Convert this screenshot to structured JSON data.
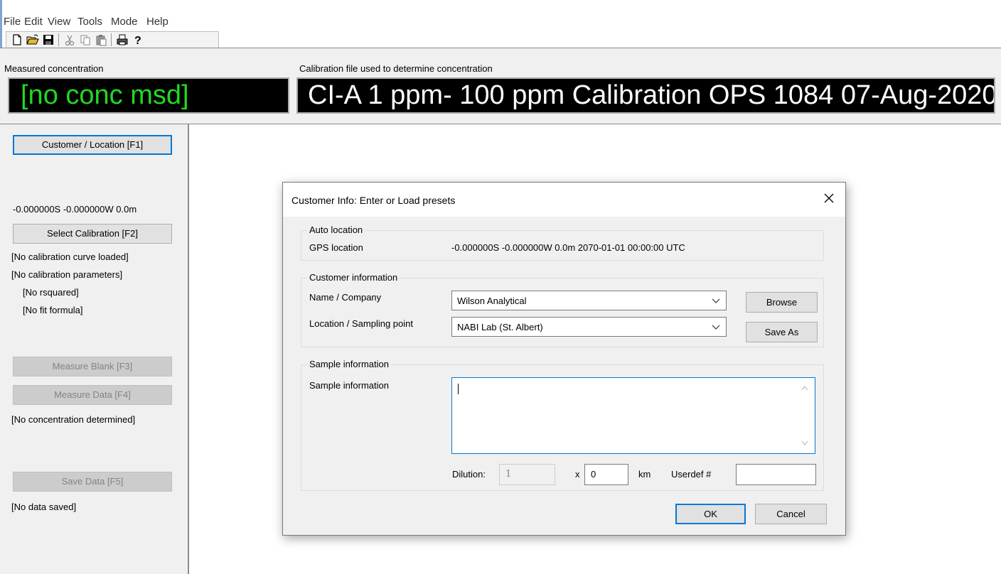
{
  "menu": [
    "File",
    "Edit",
    "View",
    "Tools",
    "Mode",
    "Help"
  ],
  "toolbar_icons": [
    "new-file-icon",
    "open-folder-icon",
    "save-disk-icon",
    "cut-icon",
    "copy-icon",
    "paste-icon",
    "print-icon",
    "help-icon"
  ],
  "header": {
    "conc_label": "Measured concentration",
    "conc_value": "[no conc msd]",
    "calib_label": "Calibration file used to determine concentration",
    "calib_value": "CI-A 1 ppm- 100 ppm Calibration OPS 1084 07-Aug-2020",
    "conc_color": "#21d921"
  },
  "left": {
    "customer_button": "Customer / Location [F1]",
    "gps": "-0.000000S -0.000000W 0.0m",
    "select_calibration": "Select Calibration [F2]",
    "no_curve": "[No calibration curve loaded]",
    "no_params": "[No calibration parameters]",
    "no_rsquared": "[No rsquared]",
    "no_fit": "[No fit formula]",
    "measure_blank": "Measure Blank [F3]",
    "measure_data": "Measure Data [F4]",
    "no_conc": "[No concentration determined]",
    "save_data": "Save Data [F5]",
    "no_saved": "[No data saved]"
  },
  "dialog": {
    "title": "Customer Info: Enter or Load presets",
    "auto_location_title": "Auto location",
    "gps_label": "GPS location",
    "gps_value": "-0.000000S -0.000000W 0.0m 2070-01-01 00:00:00 UTC",
    "customer_info_title": "Customer information",
    "name_label": "Name / Company",
    "name_value": "Wilson Analytical",
    "location_label": "Location / Sampling point",
    "location_value": "NABI Lab (St. Albert)",
    "browse": "Browse",
    "save_as": "Save As",
    "sample_info_title": "Sample information",
    "sample_label": "Sample information",
    "sample_value": "",
    "dilution_label": "Dilution:",
    "dilution_value": "1",
    "x_label": "x",
    "km_value": "0",
    "km_label": "km",
    "userdef_label": "Userdef #",
    "userdef_value": "",
    "ok": "OK",
    "cancel": "Cancel"
  }
}
